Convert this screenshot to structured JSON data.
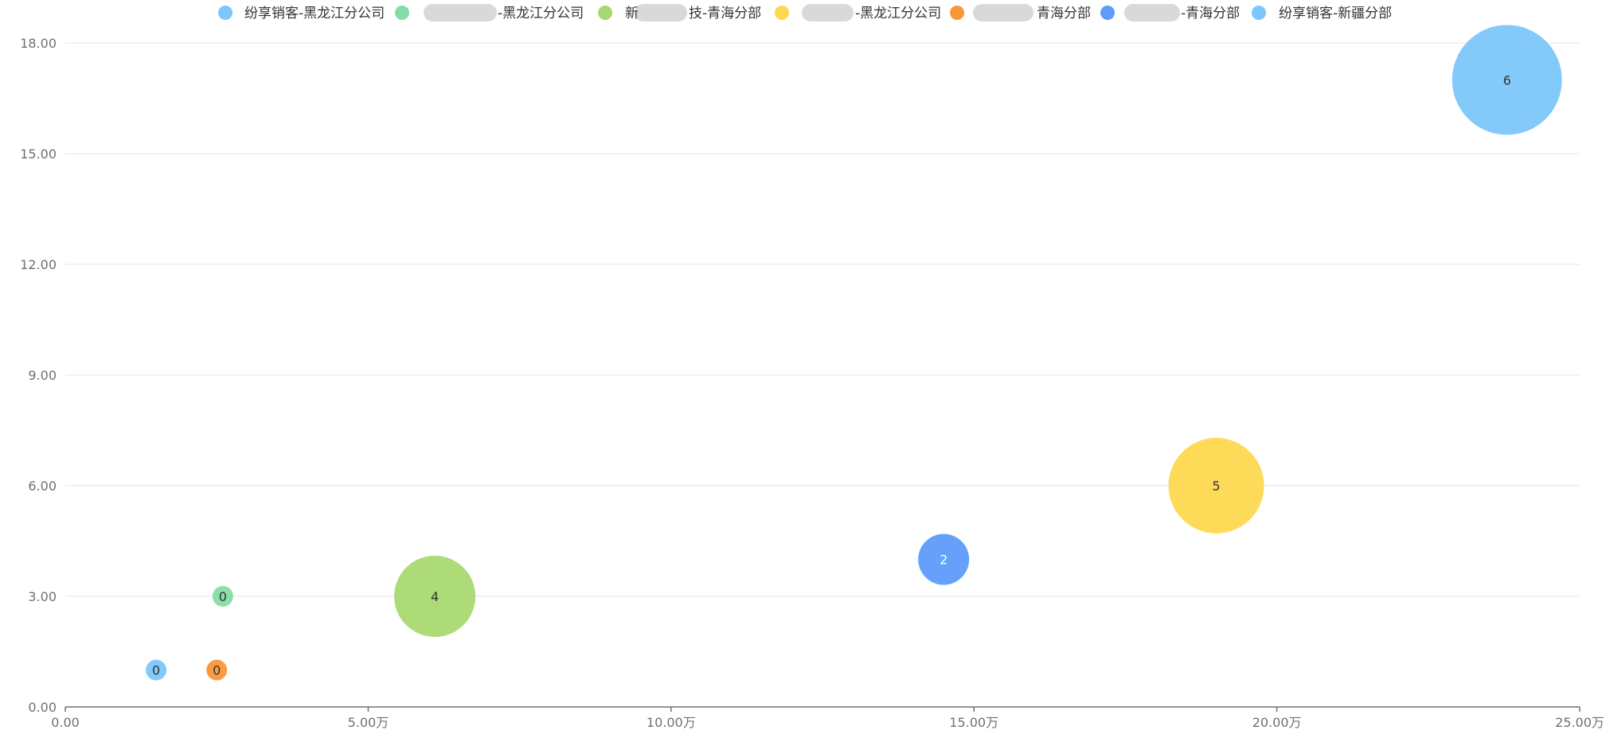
{
  "chart_data": {
    "type": "scatter",
    "subtype": "bubble",
    "title": "",
    "xlabel": "",
    "ylabel": "",
    "xlim": [
      0,
      250000
    ],
    "ylim": [
      0,
      18
    ],
    "x_ticks": [
      {
        "value": 0,
        "label": "0.00"
      },
      {
        "value": 50000,
        "label": "5.00万"
      },
      {
        "value": 100000,
        "label": "10.00万"
      },
      {
        "value": 150000,
        "label": "15.00万"
      },
      {
        "value": 200000,
        "label": "20.00万"
      },
      {
        "value": 250000,
        "label": "25.00万"
      }
    ],
    "y_ticks": [
      {
        "value": 0,
        "label": "0.00"
      },
      {
        "value": 3,
        "label": "3.00"
      },
      {
        "value": 6,
        "label": "6.00"
      },
      {
        "value": 9,
        "label": "9.00"
      },
      {
        "value": 12,
        "label": "12.00"
      },
      {
        "value": 15,
        "label": "15.00"
      },
      {
        "value": 18,
        "label": "18.00"
      }
    ],
    "grid": true,
    "legend_position": "top",
    "series": [
      {
        "name": "纷享销客-黑龙江分公司",
        "color": "#7cc7fb",
        "points": [
          {
            "x": 15000,
            "y": 1,
            "size": 0,
            "label": "0"
          }
        ]
      },
      {
        "name": "-黑龙江分公司",
        "name_prefix": "",
        "color": "#86dca7",
        "points": [
          {
            "x": 26000,
            "y": 3,
            "size": 0,
            "label": "0"
          }
        ]
      },
      {
        "name": "技-青海分部",
        "name_prefix": "新",
        "color": "#a8d970",
        "points": [
          {
            "x": 61000,
            "y": 3,
            "size": 4,
            "label": "4"
          }
        ]
      },
      {
        "name": "-黑龙江分公司",
        "name_prefix": "",
        "color": "#fed850",
        "points": [
          {
            "x": 190000,
            "y": 6,
            "size": 5,
            "label": "5"
          }
        ]
      },
      {
        "name": "青海分部",
        "name_prefix": "",
        "color": "#f9963a",
        "points": [
          {
            "x": 25000,
            "y": 1,
            "size": 0,
            "label": "0"
          }
        ]
      },
      {
        "name": "-青海分部",
        "name_prefix": "",
        "color": "#5d9cfa",
        "points": [
          {
            "x": 145000,
            "y": 4,
            "size": 2,
            "label": "2"
          }
        ]
      },
      {
        "name": "纷享销客-新疆分部",
        "color": "#7cc7fb",
        "points": [
          {
            "x": 238000,
            "y": 17,
            "size": 6,
            "label": "6"
          }
        ]
      }
    ]
  }
}
